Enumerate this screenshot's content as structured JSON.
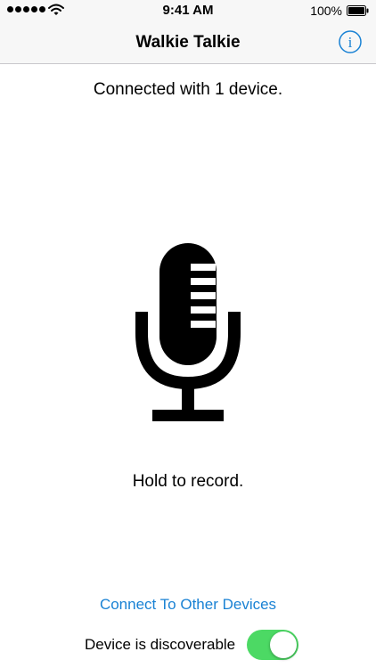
{
  "status_bar": {
    "time": "9:41 AM",
    "battery": "100%",
    "icons": [
      "signal-icon",
      "wifi-icon",
      "battery-icon"
    ]
  },
  "nav": {
    "title": "Walkie Talkie",
    "info_icon": "info-icon",
    "info_label": "i"
  },
  "main": {
    "connection_status": "Connected with 1 device.",
    "mic_icon": "microphone-icon",
    "record_hint": "Hold to record."
  },
  "footer": {
    "connect_link": "Connect To Other Devices",
    "discoverable_label": "Device is discoverable",
    "discoverable_on": true
  },
  "colors": {
    "accent": "#1a82d4",
    "toggle_on": "#4cd964",
    "bar_background": "#f7f7f7"
  }
}
